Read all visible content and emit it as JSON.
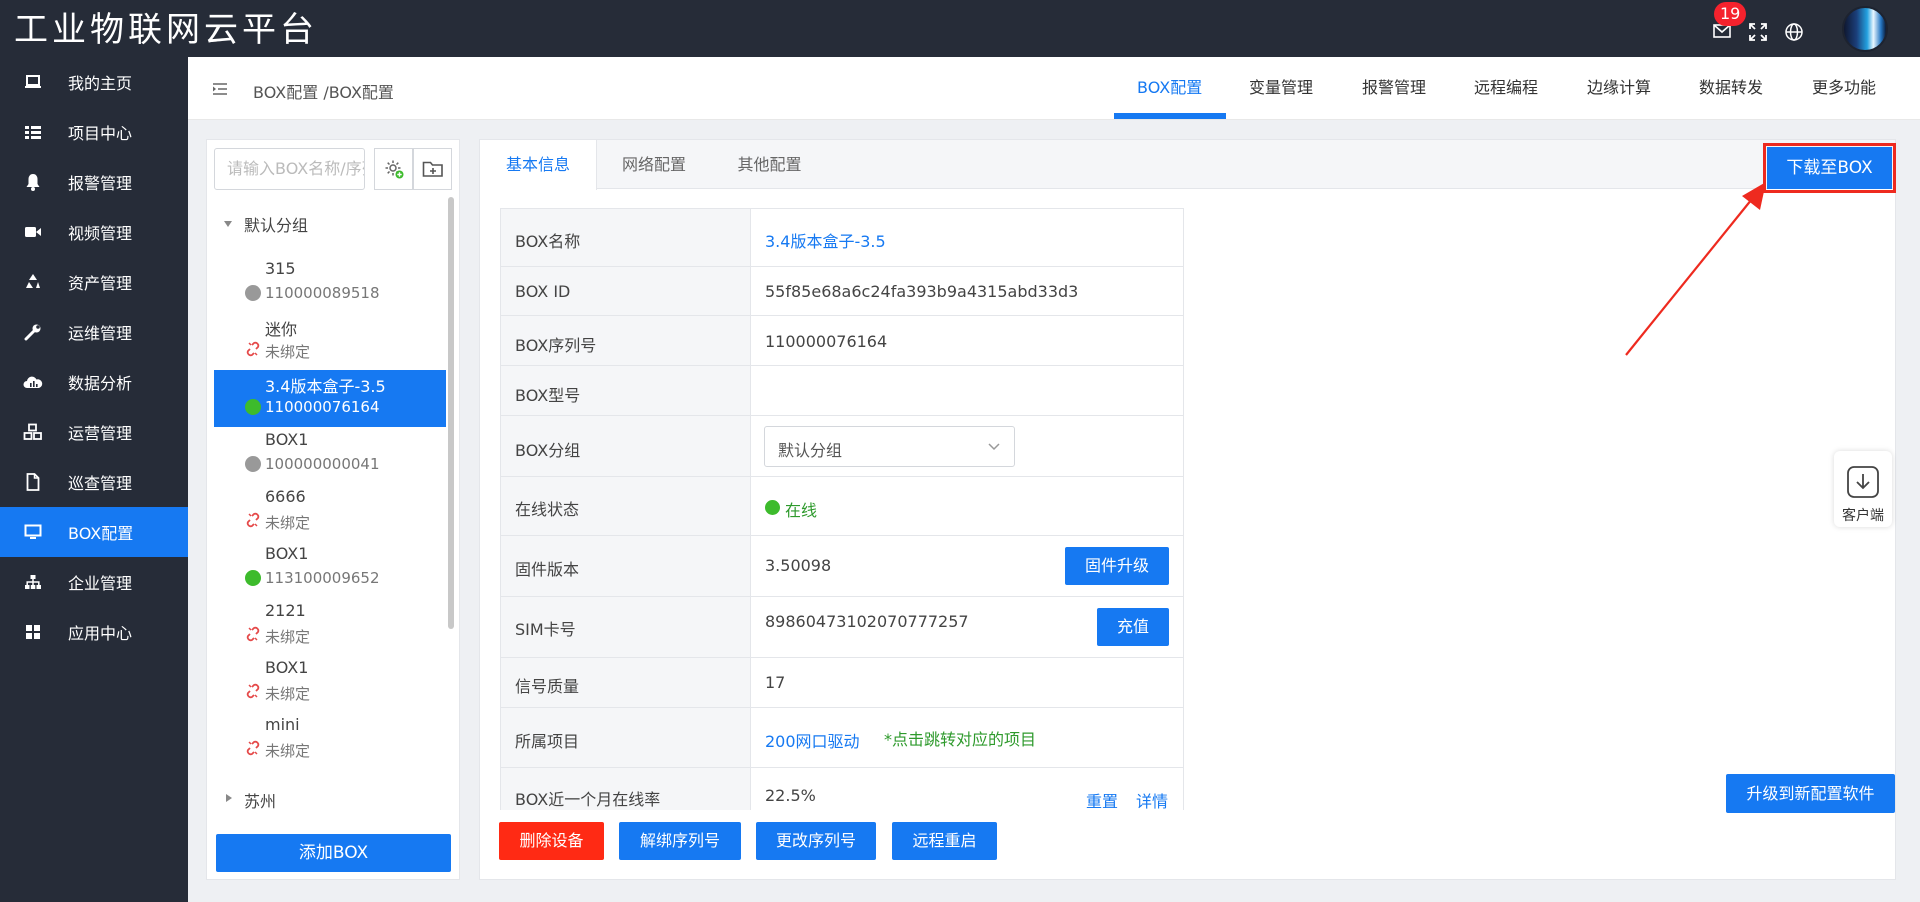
{
  "app": {
    "title": "工业物联网云平台",
    "notification_count": "19",
    "colors": {
      "primary": "#1679f2",
      "sidebar": "#262c38",
      "danger": "#ff2a14",
      "online": "#3dbb2c",
      "offline": "#999999",
      "highlight": "#ee2a1f"
    }
  },
  "sidebar": {
    "items": [
      {
        "label": "我的主页",
        "icon": "laptop-icon"
      },
      {
        "label": "项目中心",
        "icon": "list-icon"
      },
      {
        "label": "报警管理",
        "icon": "bell-icon"
      },
      {
        "label": "视频管理",
        "icon": "video-camera-icon"
      },
      {
        "label": "资产管理",
        "icon": "recycle-icon"
      },
      {
        "label": "运维管理",
        "icon": "wrench-icon"
      },
      {
        "label": "数据分析",
        "icon": "cloud-chart-icon"
      },
      {
        "label": "运营管理",
        "icon": "cubes-icon"
      },
      {
        "label": "巡查管理",
        "icon": "file-icon"
      },
      {
        "label": "BOX配置",
        "icon": "monitor-icon",
        "active": true
      },
      {
        "label": "企业管理",
        "icon": "org-chart-icon"
      },
      {
        "label": "应用中心",
        "icon": "apps-grid-icon"
      }
    ]
  },
  "header": {
    "breadcrumb": "BOX配置 /BOX配置",
    "tabs": [
      "BOX配置",
      "变量管理",
      "报警管理",
      "远程编程",
      "边缘计算",
      "数据转发",
      "更多功能"
    ],
    "active_tab": "BOX配置"
  },
  "tree": {
    "search_placeholder": "请输入BOX名称/序列号",
    "groups": [
      "默认分组",
      "苏州"
    ],
    "devices": [
      {
        "name": "315",
        "sub": "110000089518",
        "status": "offline"
      },
      {
        "name": "迷你",
        "sub": "未绑定",
        "status": "unbound"
      },
      {
        "name": "3.4版本盒子-3.5",
        "sub": "110000076164",
        "status": "online",
        "selected": true
      },
      {
        "name": "BOX1",
        "sub": "100000000041",
        "status": "offline"
      },
      {
        "name": "6666",
        "sub": "未绑定",
        "status": "unbound"
      },
      {
        "name": "BOX1",
        "sub": "113100009652",
        "status": "online"
      },
      {
        "name": "2121",
        "sub": "未绑定",
        "status": "unbound"
      },
      {
        "name": "BOX1",
        "sub": "未绑定",
        "status": "unbound"
      },
      {
        "name": "mini",
        "sub": "未绑定",
        "status": "unbound"
      }
    ],
    "add_button": "添加BOX"
  },
  "content": {
    "subtabs": [
      "基本信息",
      "网络配置",
      "其他配置"
    ],
    "download_button": "下载至BOX",
    "fields": {
      "box_name": {
        "label": "BOX名称",
        "value": "3.4版本盒子-3.5"
      },
      "box_id": {
        "label": "BOX ID",
        "value": "55f85e68a6c24fa393b9a4315abd33d3"
      },
      "serial": {
        "label": "BOX序列号",
        "value": "110000076164"
      },
      "model": {
        "label": "BOX型号",
        "value": ""
      },
      "group": {
        "label": "BOX分组",
        "value": "默认分组"
      },
      "status": {
        "label": "在线状态",
        "value": "在线"
      },
      "firmware": {
        "label": "固件版本",
        "value": "3.50098",
        "button": "固件升级"
      },
      "sim": {
        "label": "SIM卡号",
        "value": "89860473102070777257",
        "button": "充值"
      },
      "signal": {
        "label": "信号质量",
        "value": "17"
      },
      "project": {
        "label": "所属项目",
        "value": "200网口驱动",
        "hint": "*点击跳转对应的项目"
      },
      "online_rate": {
        "label": "BOX近一个月在线率",
        "value": "22.5%",
        "reset": "重置",
        "detail": "详情"
      }
    },
    "actions": {
      "delete": "删除设备",
      "unbind": "解绑序列号",
      "change_serial": "更改序列号",
      "reboot": "远程重启"
    },
    "upgrade_button": "升级到新配置软件",
    "client_label": "客户端"
  }
}
